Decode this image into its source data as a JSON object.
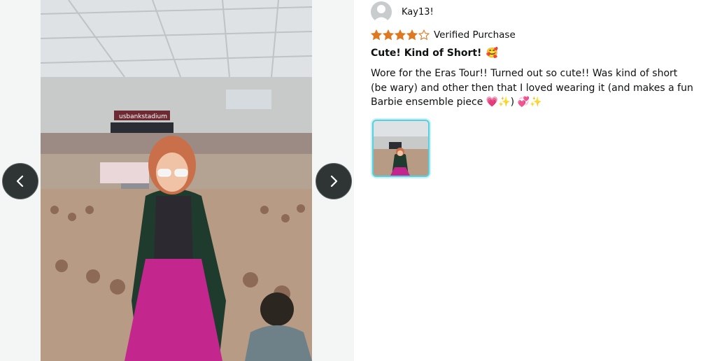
{
  "gallery": {
    "photo_description": "",
    "prev_icon": "chevron-left-icon",
    "next_icon": "chevron-right-icon",
    "stadium_sign": "usbankstadium"
  },
  "review": {
    "avatar_icon": "user-avatar-icon",
    "username": "Kay13!",
    "rating": 4,
    "rating_max": 5,
    "verified_label": "Verified Purchase",
    "title": "Cute! Kind of Short!",
    "title_emoji": "🥰",
    "body": "Wore for the Eras Tour!! Turned out so cute!! Was kind of short (be wary) and other then that I loved wearing it (and makes a fun Barbie ensemble piece 💗✨) 💞✨",
    "accent_star_color": "#de7921",
    "thumbnail_border_color": "#59d0dd"
  }
}
